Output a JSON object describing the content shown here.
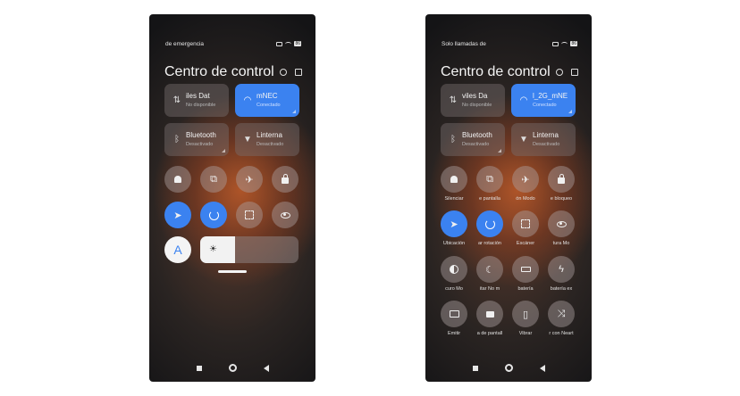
{
  "phone_left": {
    "status": {
      "text": "de emergencia",
      "battery": "86"
    },
    "title": "Centro de control",
    "tiles": [
      {
        "name": "iles     Dat",
        "sub": "No disponible",
        "icon": "data-arrows-icon"
      },
      {
        "name": "mNEC",
        "sub": "Conectado",
        "icon": "wifi-icon"
      },
      {
        "name": "Bluetooth",
        "sub": "Desactivado",
        "icon": "bluetooth-icon"
      },
      {
        "name": "Linterna",
        "sub": "Desactivado",
        "icon": "flashlight-icon"
      }
    ],
    "buttons": [
      {
        "icon": "bell-icon"
      },
      {
        "icon": "screenshot-icon"
      },
      {
        "icon": "airplane-icon"
      },
      {
        "icon": "lock-icon"
      },
      {
        "icon": "location-icon"
      },
      {
        "icon": "rotation-lock-icon"
      },
      {
        "icon": "scanner-icon"
      },
      {
        "icon": "eye-icon"
      }
    ],
    "auto_brightness": {
      "glyph": "A"
    },
    "brightness": {
      "level": 0.35,
      "sun": "☀"
    }
  },
  "phone_right": {
    "status": {
      "text": "Solo llamadas de",
      "battery": "86"
    },
    "title": "Centro de control",
    "tiles": [
      {
        "name": "viles     Da",
        "sub": "No disponible",
        "icon": "data-arrows-icon"
      },
      {
        "name": "l_2G_mNE",
        "sub": "Conectado",
        "icon": "wifi-icon"
      },
      {
        "name": "Bluetooth",
        "sub": "Desactivado",
        "icon": "bluetooth-icon"
      },
      {
        "name": "Linterna",
        "sub": "Desactivado",
        "icon": "flashlight-icon"
      }
    ],
    "buttons": [
      {
        "label": "Silenciar",
        "icon": "bell-icon"
      },
      {
        "label": "e pantalla",
        "icon": "screenshot-icon"
      },
      {
        "label": "ón     Modo",
        "icon": "airplane-icon"
      },
      {
        "label": "e bloqueo",
        "icon": "lock-icon"
      },
      {
        "label": "Ubicación",
        "icon": "location-icon"
      },
      {
        "label": "ar rotación",
        "icon": "rotation-lock-icon"
      },
      {
        "label": "Escáner",
        "icon": "scanner-icon"
      },
      {
        "label": "tura     Mo",
        "icon": "eye-icon"
      },
      {
        "label": "curo     Mo",
        "icon": "dark-mode-icon"
      },
      {
        "label": "itar     No m",
        "icon": "moon-icon"
      },
      {
        "label": "batería",
        "icon": "battery-saver-icon"
      },
      {
        "label": "batería ex",
        "icon": "battery-bolt-icon"
      },
      {
        "label": "Emitir",
        "icon": "cast-icon"
      },
      {
        "label": "a de pantall",
        "icon": "screen-record-icon"
      },
      {
        "label": "Vibrar",
        "icon": "vibrate-icon"
      },
      {
        "label": "r con Neart",
        "icon": "nearby-share-icon"
      }
    ]
  }
}
